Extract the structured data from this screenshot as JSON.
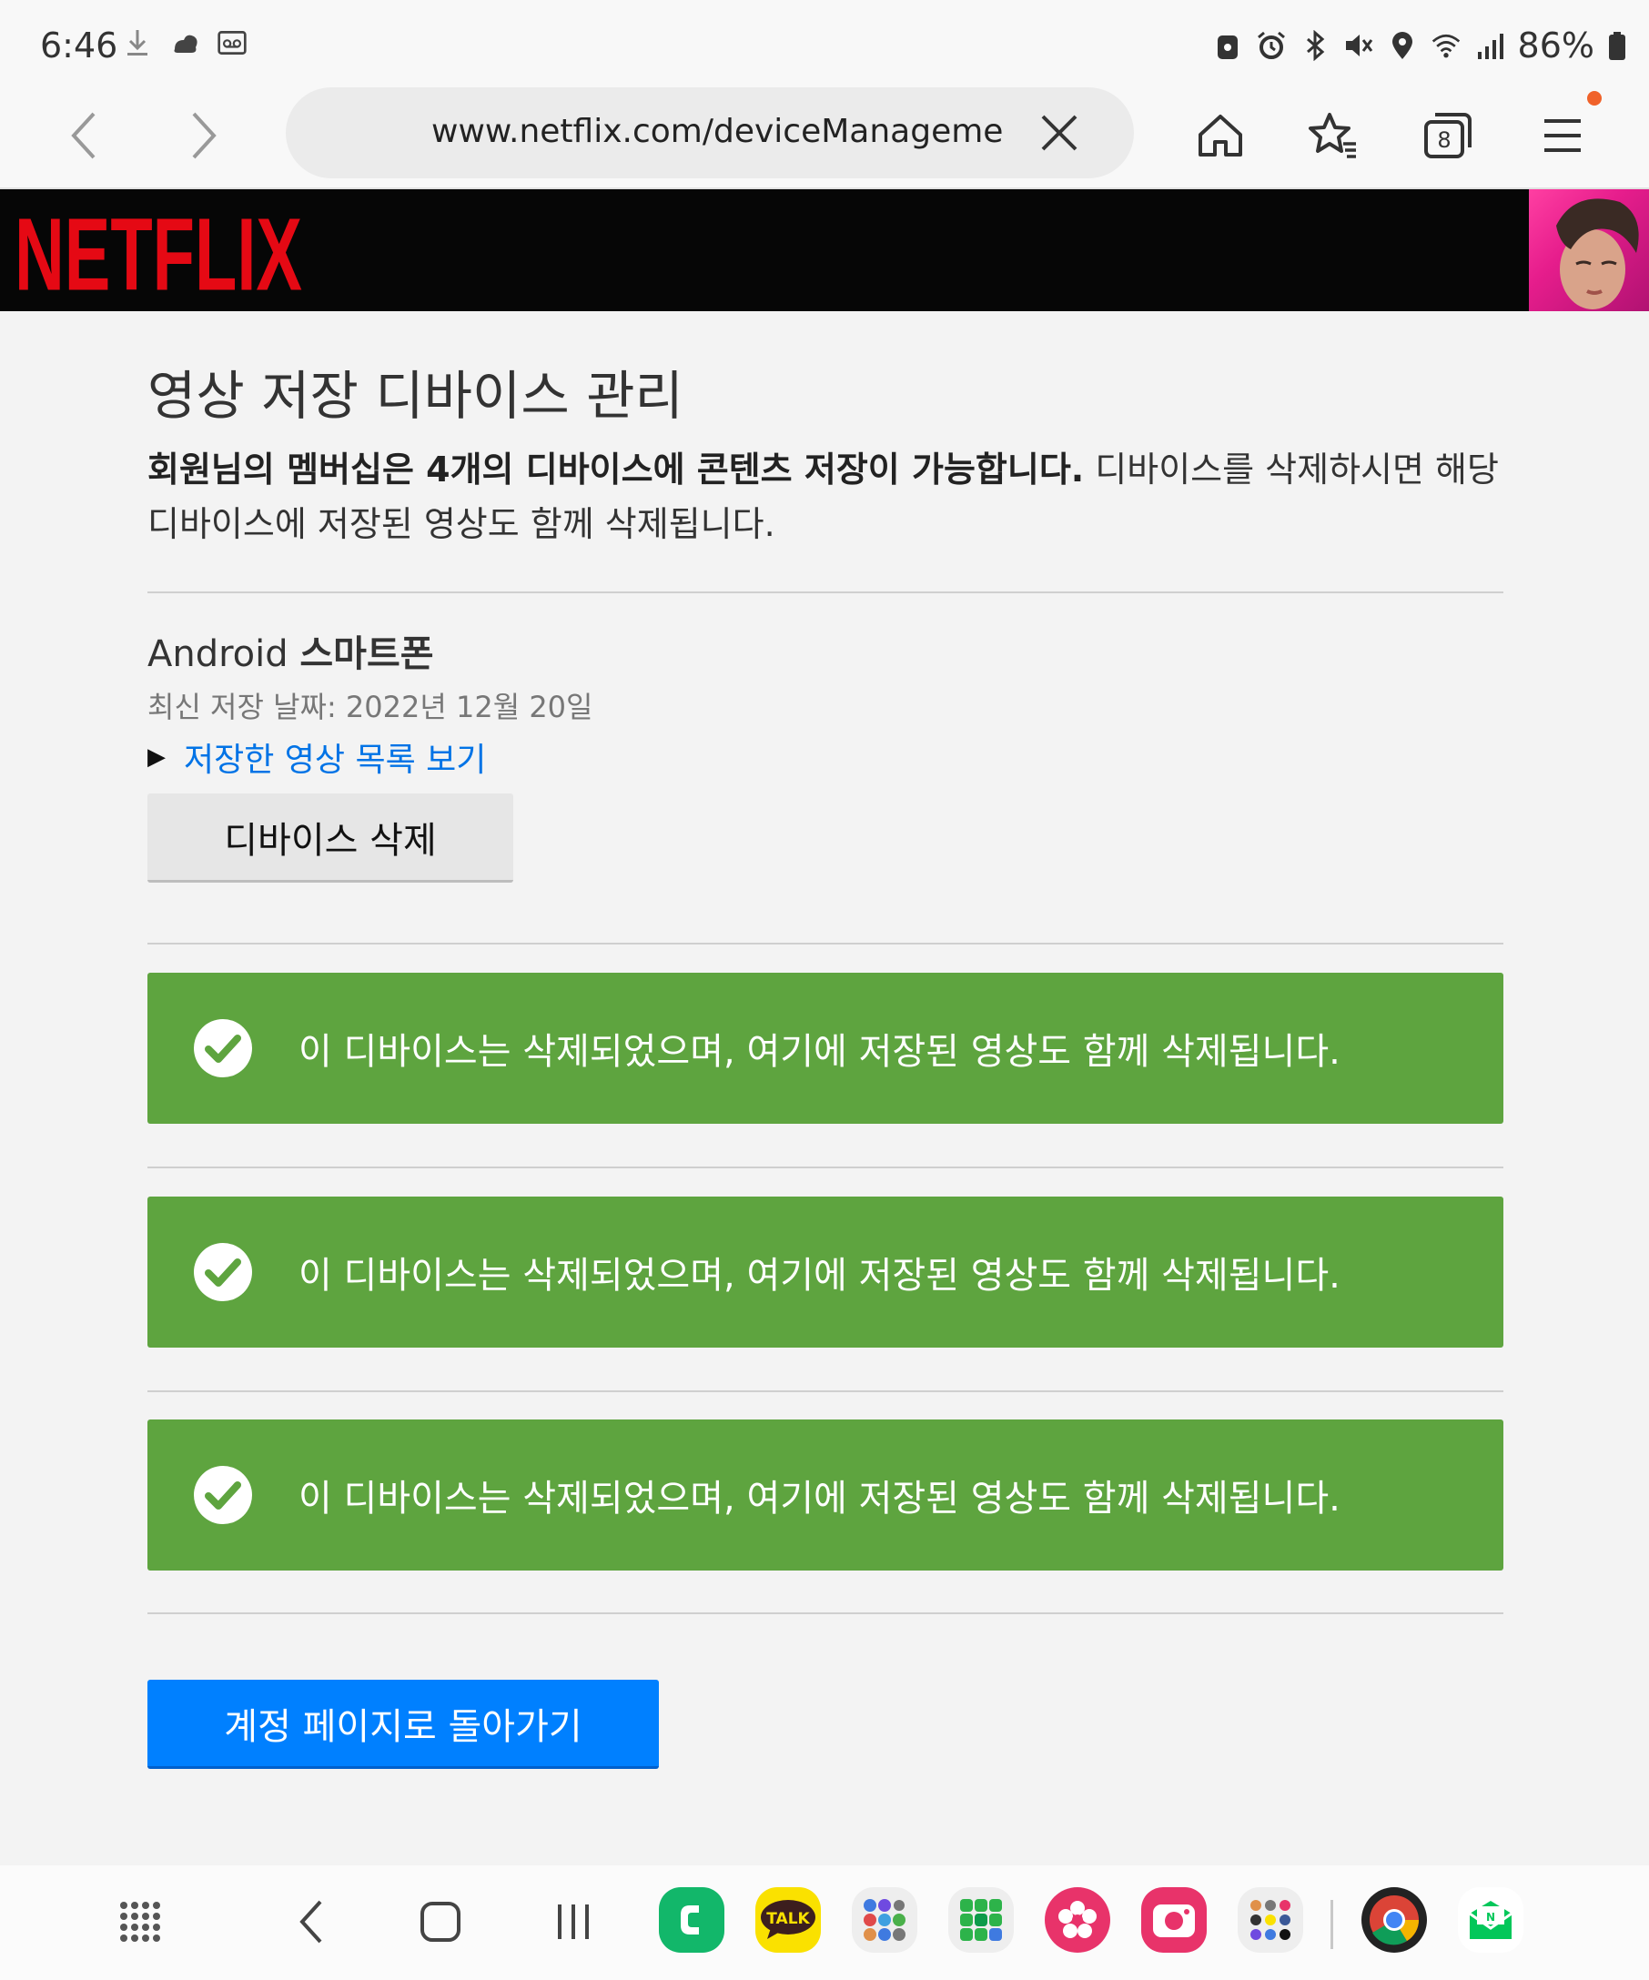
{
  "status_bar": {
    "time": "6:46",
    "battery": "86%",
    "left_icons": [
      "download-icon",
      "weather-icon",
      "voicemail-icon"
    ],
    "right_icons": [
      "sim-lock-icon",
      "alarm-icon",
      "bluetooth-icon",
      "mute-icon",
      "location-icon",
      "wifi-icon",
      "signal-icon",
      "battery-icon"
    ]
  },
  "browser": {
    "url": "www.netflix.com/deviceManageme",
    "tab_count": "8",
    "icons": [
      "back-icon",
      "forward-icon",
      "clear-icon",
      "home-icon",
      "bookmark-icon",
      "tabs-icon",
      "menu-icon"
    ]
  },
  "header": {
    "logo": "NETFLIX"
  },
  "page": {
    "title": "영상 저장 디바이스 관리",
    "desc_bold": "회원님의 멤버십은 4개의 디바이스에 콘텐츠 저장이 가능합니다.",
    "desc_rest": " 디바이스를 삭제하시면 해당 디바이스에 저장된 영상도 함께 삭제됩니다.",
    "device": {
      "name_prefix": "Android",
      "name_bold": "스마트폰",
      "last_download": "최신 저장 날짜: 2022년 12월 20일",
      "view_link": "저장한 영상 목록 보기",
      "remove_button": "디바이스 삭제"
    },
    "success_messages": [
      "이 디바이스는 삭제되었으며, 여기에 저장된 영상도 함께 삭제됩니다.",
      "이 디바이스는 삭제되었으며, 여기에 저장된 영상도 함께 삭제됩니다.",
      "이 디바이스는 삭제되었으며, 여기에 저장된 영상도 함께 삭제됩니다."
    ],
    "back_button": "계정 페이지로 돌아가기"
  },
  "navbar": {
    "apps": [
      "Phone",
      "TALK",
      "folder-1",
      "folder-2",
      "Gallery",
      "Camera",
      "folder-3",
      "Chrome",
      "Naver-mail"
    ],
    "talk_label": "TALK",
    "colors": {
      "phone": "#12b76a",
      "talk": "#fae100",
      "gallery": "#e8336a",
      "camera": "#e8336a"
    }
  },
  "colors": {
    "netflix_red": "#e50914",
    "success_green": "#5ea43f",
    "link_blue": "#0073e6",
    "primary_blue": "#0080ff"
  }
}
